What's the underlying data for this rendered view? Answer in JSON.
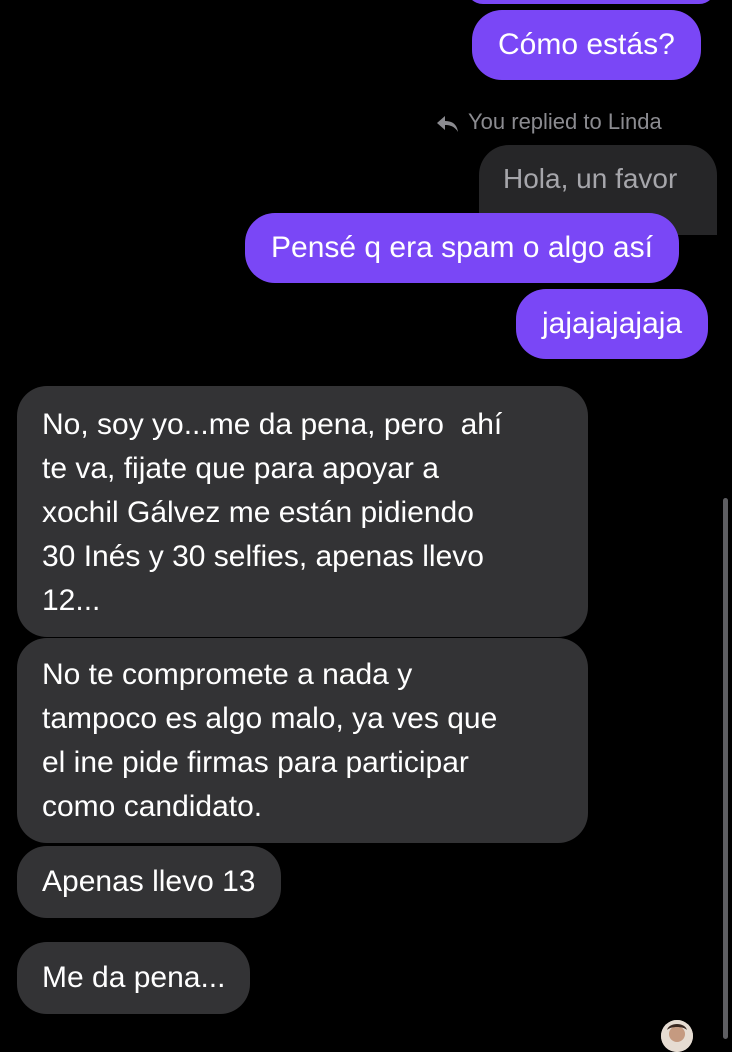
{
  "conversation": {
    "reply_header": "You replied to Linda",
    "replied_to_preview": "Hola, un favor",
    "messages": [
      {
        "from": "me",
        "text": "Cómo estás?"
      },
      {
        "from": "me",
        "text": "Pensé q era spam o algo así"
      },
      {
        "from": "me",
        "text": "jajajajajaja"
      },
      {
        "from": "them",
        "text": "No, soy yo...me da pena, pero  ahí\nte va, fijate que para apoyar a\nxochil Gálvez me están pidiendo\n30 Inés y 30 selfies, apenas llevo\n12..."
      },
      {
        "from": "them",
        "text": "No te compromete a nada y\ntampoco es algo malo, ya ves que\nel ine pide firmas para participar\ncomo candidato."
      },
      {
        "from": "them",
        "text": "Apenas llevo 13"
      },
      {
        "from": "them",
        "text": "Me da pena..."
      }
    ]
  },
  "colors": {
    "background": "#000000",
    "outgoing_bubble": "#7a47f6",
    "incoming_bubble": "#333335"
  },
  "icons": {
    "reply": "reply-arrow-icon"
  }
}
